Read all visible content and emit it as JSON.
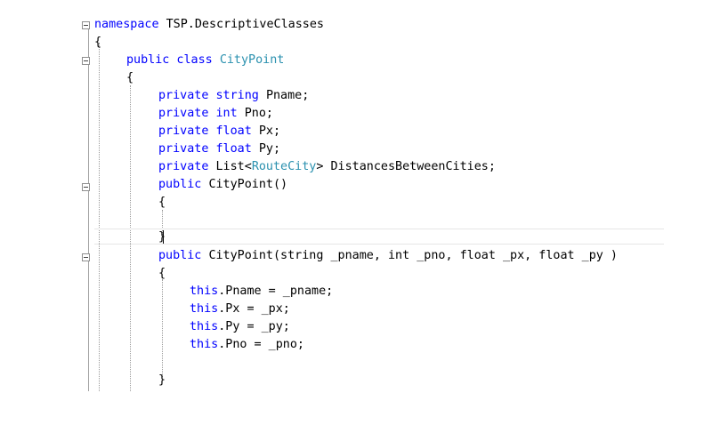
{
  "editor": {
    "lines": [
      {
        "k": "namespace ",
        "n": "TSP.DescriptiveClasses"
      },
      {
        "n": "{"
      },
      {
        "k": "public class ",
        "t": "CityPoint"
      },
      {
        "n": "{"
      },
      {
        "k": "private string ",
        "n": "Pname;"
      },
      {
        "k": "private int ",
        "n": "Pno;"
      },
      {
        "k": "private float ",
        "n": "Px;"
      },
      {
        "k": "private float ",
        "n": "Py;"
      },
      {
        "k": "private ",
        "n1": "List<",
        "t": "RouteCity",
        "n": "> DistancesBetweenCities;"
      },
      {
        "k": "public ",
        "n": "CityPoint()"
      },
      {
        "n": "{"
      },
      {
        "n": ""
      },
      {
        "n": "}"
      },
      {
        "k": "public ",
        "n": "CityPoint(string _pname, int _pno, float _px, float _py )"
      },
      {
        "n": "{"
      },
      {
        "k": "this",
        "n": ".Pname = _pname;"
      },
      {
        "k": "this",
        "n": ".Px = _px;"
      },
      {
        "k": "this",
        "n": ".Py = _py;"
      },
      {
        "k": "this",
        "n": ".Pno = _pno;"
      },
      {
        "n": ""
      },
      {
        "n": "}"
      }
    ]
  }
}
